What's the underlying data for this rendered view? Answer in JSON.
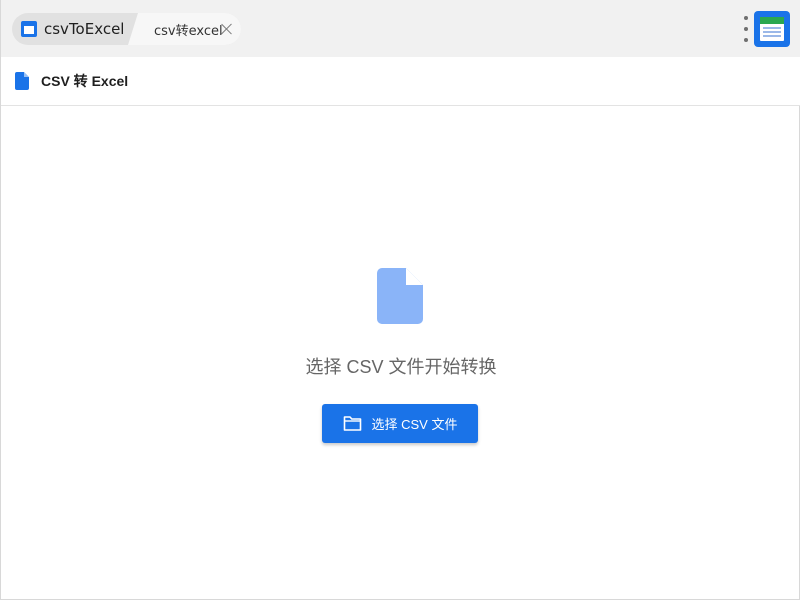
{
  "tabs": {
    "app_label": "csvToExcel",
    "page_label": "csv转excel"
  },
  "header": {
    "title": "CSV 转 Excel"
  },
  "main": {
    "prompt": "选择 CSV 文件开始转换",
    "choose_button_label": "选择 CSV 文件"
  },
  "icons": {
    "app": "app-window-icon",
    "close": "close-icon",
    "menu": "more-vert-icon",
    "corner_app": "csv-to-excel-app-icon",
    "header_doc": "file-icon",
    "big_doc": "file-icon",
    "folder": "folder-icon"
  },
  "colors": {
    "accent": "#1a73e8",
    "file_icon_light": "#8ab4f8",
    "tabbar_bg": "#f1f1f1"
  }
}
